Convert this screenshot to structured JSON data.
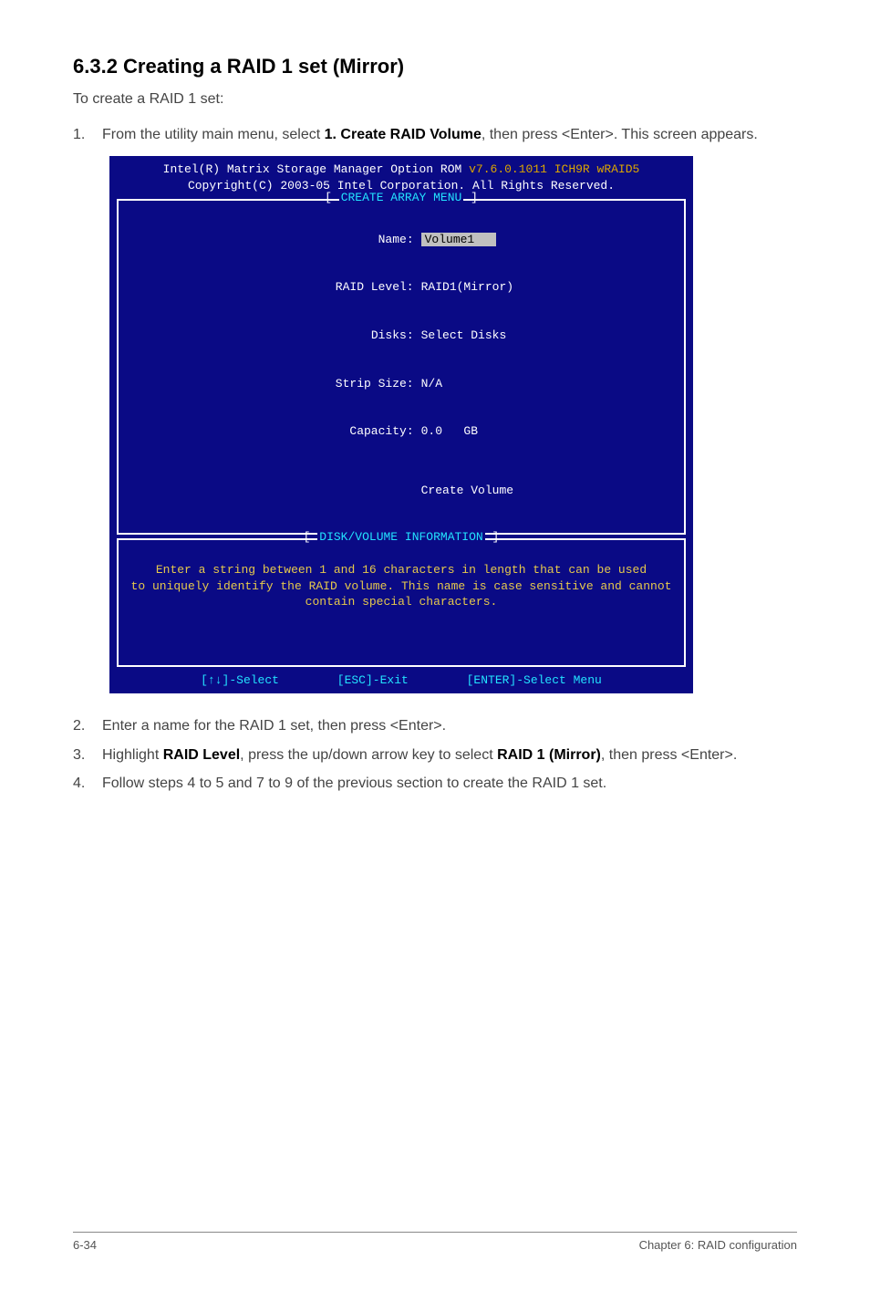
{
  "heading": "6.3.2    Creating a RAID 1 set (Mirror)",
  "intro": "To create a RAID 1 set:",
  "step1": {
    "num": "1.",
    "pre": "From the utility main menu, select ",
    "bold": "1. Create RAID Volume",
    "post": ", then press <Enter>. This screen appears."
  },
  "bios": {
    "header1_pre": "Intel(R) Matrix Storage Manager Option ROM ",
    "header1_hilite": "v7.6.0.1011 ICH9R wRAID5",
    "header2": "Copyright(C) 2003-05 Intel Corporation. All Rights Reserved.",
    "panel1_title": "CREATE ARRAY MENU",
    "form": {
      "name_label": "Name:",
      "name_value": "Volume1",
      "raid_label": "RAID Level:",
      "raid_value": "RAID1(Mirror)",
      "disks_label": "Disks:",
      "disks_value": "Select Disks",
      "strip_label": "Strip Size:",
      "strip_value": "N/A",
      "capacity_label": "Capacity:",
      "capacity_value": "0.0   GB",
      "create": "Create Volume"
    },
    "panel2_title": "DISK/VOLUME INFORMATION",
    "info_l1": "Enter a string between 1 and 16 characters in length that can be used",
    "info_l2": "to uniquely identify the RAID volume. This name is case sensitive and cannot",
    "info_l3": "contain special characters.",
    "footer_select": "[↑↓]-Select",
    "footer_exit": "[ESC]-Exit",
    "footer_enter": "[ENTER]-Select Menu"
  },
  "step2": {
    "num": "2.",
    "text": "Enter a name for the RAID 1 set, then press <Enter>."
  },
  "step3": {
    "num": "3.",
    "pre": "Highlight ",
    "bold1": "RAID Level",
    "mid": ", press the up/down arrow key to select ",
    "bold2": "RAID 1 (Mirror)",
    "post": ", then press <Enter>."
  },
  "step4": {
    "num": "4.",
    "text": "Follow steps 4 to 5 and 7 to 9 of the previous section to create the RAID 1 set."
  },
  "footer": {
    "left": "6-34",
    "right": "Chapter 6: RAID configuration"
  }
}
